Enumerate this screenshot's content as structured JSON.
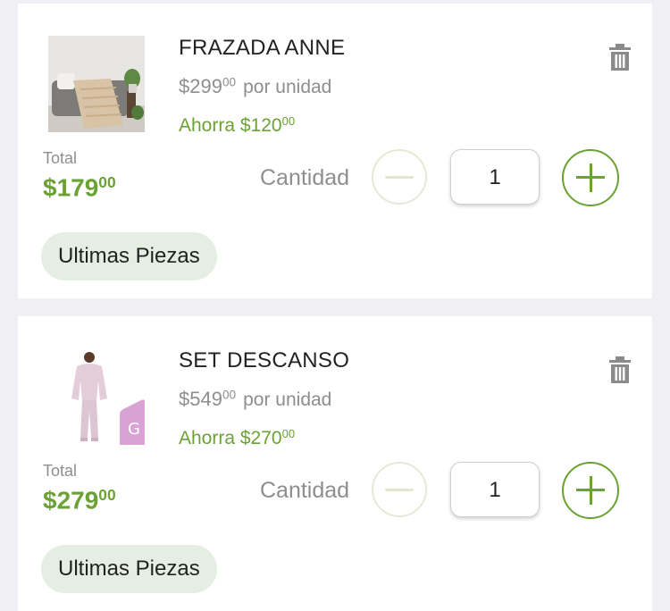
{
  "colors": {
    "accent": "#6aa233",
    "muted": "#8e8e8e",
    "badge_bg": "#e4eee2",
    "page_bg": "#efeff4"
  },
  "items": [
    {
      "name": "FRAZADA ANNE",
      "unit_price_main": "$299",
      "unit_price_cents": "00",
      "per_unit": "por unidad",
      "savings_main": "Ahorra $120",
      "savings_cents": "00",
      "total_label": "Total",
      "total_main": "$179",
      "total_cents": "00",
      "quantity_label": "Cantidad",
      "quantity": "1",
      "badge": "Ultimas Piezas",
      "icons": {
        "delete": "trash-icon",
        "decrease": "minus-icon",
        "increase": "plus-icon"
      }
    },
    {
      "name": "SET DESCANSO",
      "unit_price_main": "$549",
      "unit_price_cents": "00",
      "per_unit": "por unidad",
      "savings_main": "Ahorra $270",
      "savings_cents": "00",
      "total_label": "Total",
      "total_main": "$279",
      "total_cents": "00",
      "quantity_label": "Cantidad",
      "quantity": "1",
      "badge": "Ultimas Piezas",
      "size_tag": "G",
      "icons": {
        "delete": "trash-icon",
        "decrease": "minus-icon",
        "increase": "plus-icon"
      }
    }
  ]
}
